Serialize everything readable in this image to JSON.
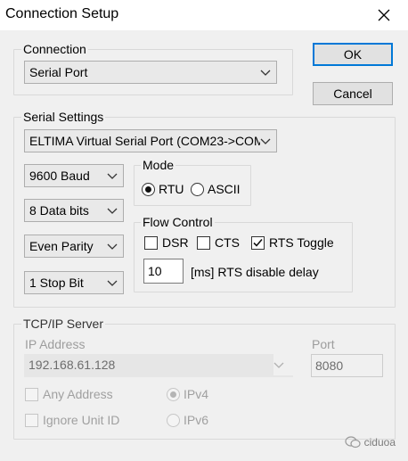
{
  "window": {
    "title": "Connection Setup"
  },
  "buttons": {
    "ok": "OK",
    "cancel": "Cancel"
  },
  "connection": {
    "group_label": "Connection",
    "selected": "Serial Port"
  },
  "serial": {
    "group_label": "Serial Settings",
    "port": "ELTIMA Virtual Serial Port (COM23->COM2",
    "baud": "9600 Baud",
    "data_bits": "8 Data bits",
    "parity": "Even Parity",
    "stop_bits": "1 Stop Bit",
    "mode": {
      "label": "Mode",
      "rtu": "RTU",
      "ascii": "ASCII",
      "selected": "RTU"
    },
    "flow": {
      "label": "Flow Control",
      "dsr": "DSR",
      "cts": "CTS",
      "rts_toggle": "RTS Toggle",
      "dsr_checked": false,
      "cts_checked": false,
      "rts_toggle_checked": true,
      "rts_delay_value": "10",
      "rts_delay_label": "[ms] RTS disable delay"
    }
  },
  "tcp": {
    "group_label": "TCP/IP Server",
    "ip_label": "IP Address",
    "ip_value": "192.168.61.128",
    "port_label": "Port",
    "port_value": "8080",
    "any_address": "Any Address",
    "ignore_unit_id": "Ignore Unit ID",
    "ipv4": "IPv4",
    "ipv6": "IPv6",
    "ipv4_selected": true
  },
  "watermark": {
    "text": "ciduoa"
  }
}
